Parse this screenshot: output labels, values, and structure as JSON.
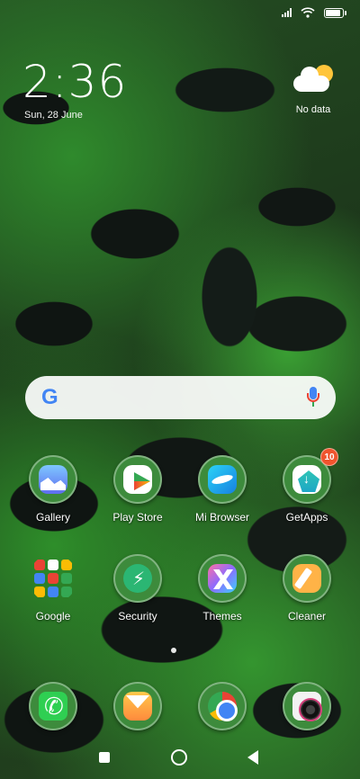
{
  "lockscreen": {
    "time": "2:36",
    "date": "Sun, 28 June"
  },
  "weather": {
    "icon": "partly-cloudy-icon",
    "text": "No data"
  },
  "search": {
    "logo": "G",
    "logo_icon": "google-g-icon",
    "mic_icon": "microphone-icon"
  },
  "apps": [
    {
      "label": "Gallery",
      "icon": "gallery-icon"
    },
    {
      "label": "Play Store",
      "icon": "play-store-icon"
    },
    {
      "label": "Mi Browser",
      "icon": "mi-browser-icon"
    },
    {
      "label": "GetApps",
      "icon": "getapps-icon",
      "badge": "10"
    },
    {
      "label": "Google",
      "icon": "google-folder-icon"
    },
    {
      "label": "Security",
      "icon": "security-icon"
    },
    {
      "label": "Themes",
      "icon": "themes-icon"
    },
    {
      "label": "Cleaner",
      "icon": "cleaner-icon"
    }
  ],
  "dock": [
    {
      "icon": "phone-icon"
    },
    {
      "icon": "messages-icon"
    },
    {
      "icon": "chrome-icon"
    },
    {
      "icon": "camera-icon"
    }
  ],
  "colors": {
    "badge": "#f0542d",
    "search_bg": "#ffffff",
    "google_blue": "#4285f4"
  }
}
